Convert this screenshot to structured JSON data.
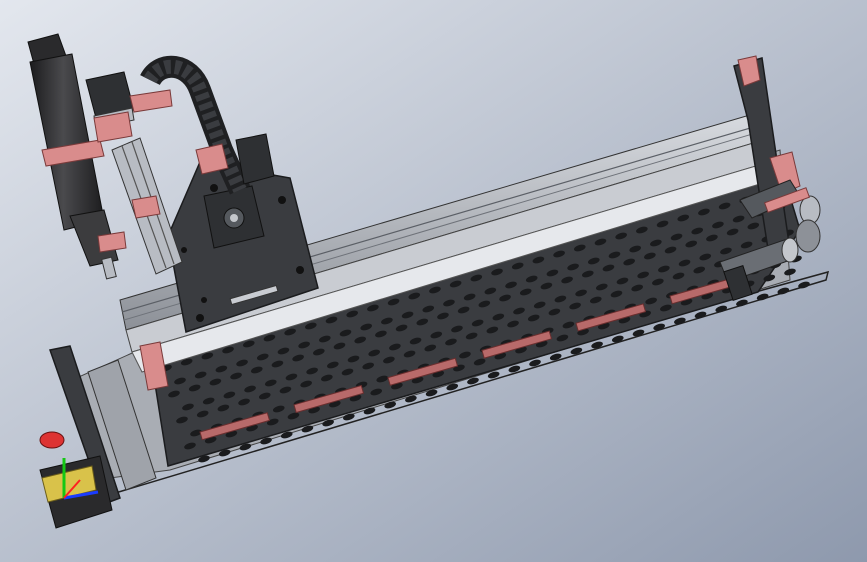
{
  "viewport": {
    "background_top": "#e3e7ee",
    "background_bottom": "#8e99ad"
  },
  "colors": {
    "frame_dark": "#2e3033",
    "frame_mid": "#55595e",
    "rail_light": "#c9ccd2",
    "rail_mid": "#9fa3aa",
    "bed_panel": "#3a3c40",
    "bed_hole": "#1a1b1d",
    "bracket_pink": "#d98c8c",
    "bracket_pink_dark": "#b86a6a",
    "motor_black": "#2a2a2c",
    "motor_silver": "#b8bcc3",
    "spindle_body": "#3c3c3e",
    "axis_x": "#1a3cff",
    "axis_y": "#14c814",
    "axis_z": "#ff2020",
    "label_yellow": "#d9c24a"
  },
  "icons": {
    "coordinate_triad": "triad-icon"
  }
}
